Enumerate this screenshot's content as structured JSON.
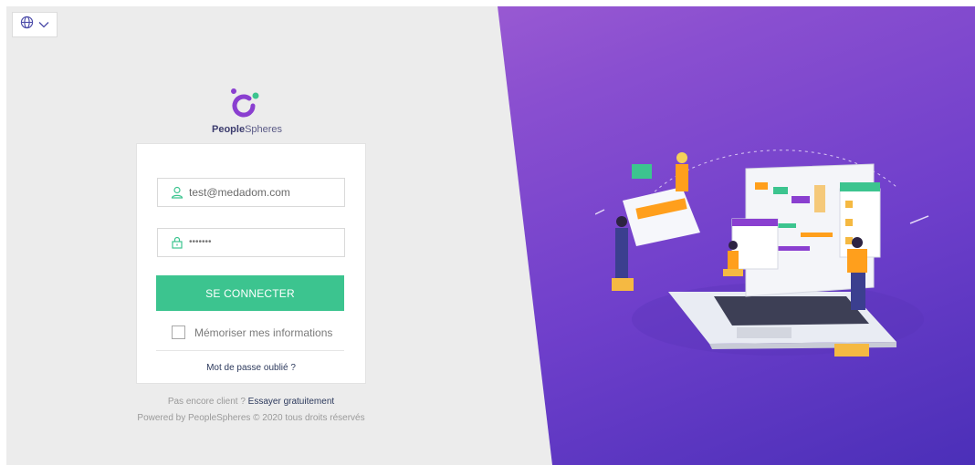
{
  "language_selector": {
    "icon": "globe-icon",
    "chevron": "chevron-down-icon"
  },
  "brand": {
    "name_bold": "People",
    "name_regular": "Spheres",
    "accent": "#3cc48f",
    "purple": "#8a3fd0"
  },
  "login": {
    "email_value": "test@medadom.com",
    "password_value": "•••••••",
    "submit_label": "SE CONNECTER",
    "remember_label": "Mémoriser mes informations",
    "forgot_label": "Mot de passe oublié ?"
  },
  "footer": {
    "not_client": "Pas encore client ?",
    "trial_link": "Essayer gratuitement",
    "powered": "Powered by PeopleSpheres © 2020 tous droits réservés"
  },
  "colors": {
    "button": "#3cc48f",
    "left_bg": "#ececec",
    "right_gradient_start": "#b06ad6",
    "right_gradient_end": "#4b2fb8"
  }
}
